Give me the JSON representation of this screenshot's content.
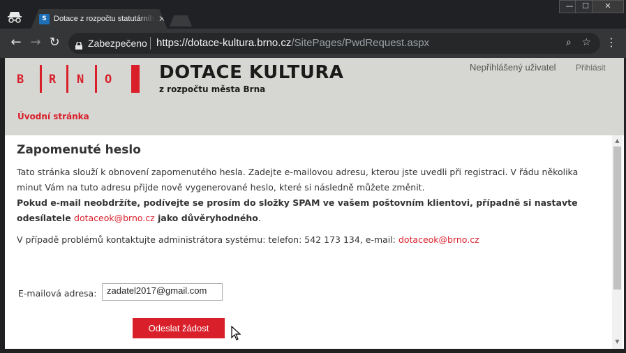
{
  "browser": {
    "tab_title": "Dotace z rozpočtu statutárního města Brna",
    "tab_close": "✕",
    "favicon_text": "S",
    "secure_label": "Zabezpečeno",
    "url_host": "https://dotace-kultura.brno.cz",
    "url_path": "/SitePages/PwdRequest.aspx",
    "window_controls": [
      "—",
      "☐",
      "✕"
    ],
    "icons": {
      "back": "←",
      "forward": "→",
      "reload": "↻",
      "zoom": "⌕",
      "star": "☆",
      "menu": "⋮"
    }
  },
  "header": {
    "logo_letters": [
      "B",
      "R",
      "N",
      "O"
    ],
    "brand_title": "DOTACE KULTURA",
    "brand_subtitle": "z rozpočtu města Brna",
    "user_status": "Nepřihlášený uživatel",
    "login_link": "Přihlásit",
    "nav_home": "Úvodní stránka"
  },
  "content": {
    "title": "Zapomenuté heslo",
    "intro": "Tato stránka slouží k obnovení zapomenutého hesla. Zadejte e-mailovou adresu, kterou jste uvedli při registraci. V řádu několika minut Vám na tuto adresu přijde nově vygenerované heslo, které si následně můžete změnit.",
    "spam_note_start": "Pokud e-mail neobdržíte, podívejte se prosím do složky SPAM ve vašem poštovním klientovi, případně si nastavte odesílatele ",
    "spam_note_email": "dotaceok@brno.cz",
    "spam_note_end": " jako důvěryhodného",
    "spam_note_period": ".",
    "contact_text": "V případě problémů kontaktujte administrátora systému: telefon: 542 173 134, e-mail: ",
    "contact_email": "dotaceok@brno.cz"
  },
  "form": {
    "email_label": "E-mailová adresa:",
    "email_value": "zadatel2017@gmail.com",
    "submit_label": "Odeslat žádost"
  },
  "scrollbar": {
    "up_arrow": "▲",
    "down_arrow": "▼"
  },
  "colors": {
    "brand_red": "#d9202a",
    "header_bg": "#d6d6d2",
    "chrome_dark": "#202124"
  }
}
